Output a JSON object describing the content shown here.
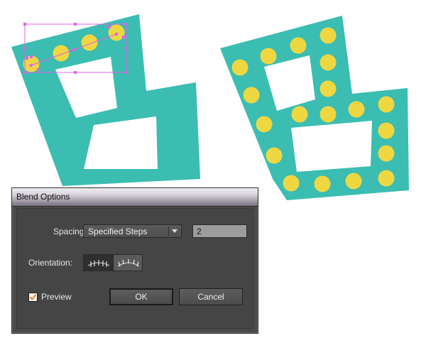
{
  "dialog": {
    "title": "Blend Options",
    "spacing_label": "Spacing:",
    "spacing_value": "Specified Steps",
    "steps_value": "2",
    "orientation_label": "Orientation:",
    "orientation_options": [
      "align-to-page-icon",
      "align-to-path-icon"
    ],
    "orientation_selected": "align-to-page",
    "preview_label": "Preview",
    "preview_checked": true,
    "ok_label": "OK",
    "cancel_label": "Cancel"
  },
  "colors": {
    "shape_fill": "#3bbdb2",
    "dot_fill": "#efd742",
    "selection": "#e062e8",
    "dialog_bg": "#4a4a4a",
    "preview_check": "#e08020"
  }
}
